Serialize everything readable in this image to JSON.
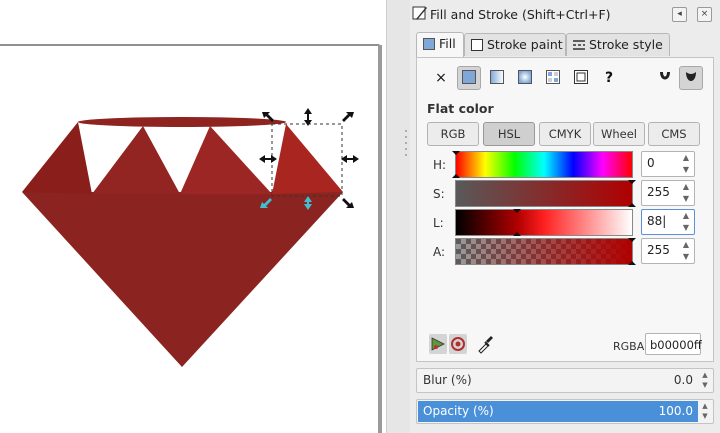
{
  "dialog": {
    "title": "Fill and Stroke (Shift+Ctrl+F)",
    "title_buttons": [
      "◂",
      "×"
    ]
  },
  "tabs": [
    {
      "label": "Fill",
      "active": true
    },
    {
      "label": "Stroke paint",
      "active": false
    },
    {
      "label": "Stroke style",
      "active": false
    }
  ],
  "paint_types": [
    "no-paint",
    "flat-color",
    "linear-gradient",
    "radial-gradient",
    "pattern",
    "swatch",
    "unset",
    "fill-rule-evenodd",
    "fill-rule-nonzero"
  ],
  "paint_symbols": {
    "none": "×",
    "unset": "?"
  },
  "fill_section": {
    "heading": "Flat color",
    "modes": [
      {
        "label": "RGB",
        "active": false
      },
      {
        "label": "HSL",
        "active": true
      },
      {
        "label": "CMYK",
        "active": false
      },
      {
        "label": "Wheel",
        "active": false
      },
      {
        "label": "CMS",
        "active": false
      }
    ],
    "channels": [
      {
        "label": "H:",
        "value": "0"
      },
      {
        "label": "S:",
        "value": "255"
      },
      {
        "label": "L:",
        "value": "88|"
      },
      {
        "label": "A:",
        "value": "255"
      }
    ],
    "rgba_label": "RGBA:",
    "rgba_value": "b00000ff"
  },
  "blur": {
    "label": "Blur (%)",
    "value": "0.0"
  },
  "opacity": {
    "label": "Opacity (%)",
    "value": "100.0",
    "level": 1.0
  },
  "colors": {
    "fill": "#b00000",
    "ruby_dark": "#8b2420",
    "accent": "#4a90d9"
  }
}
